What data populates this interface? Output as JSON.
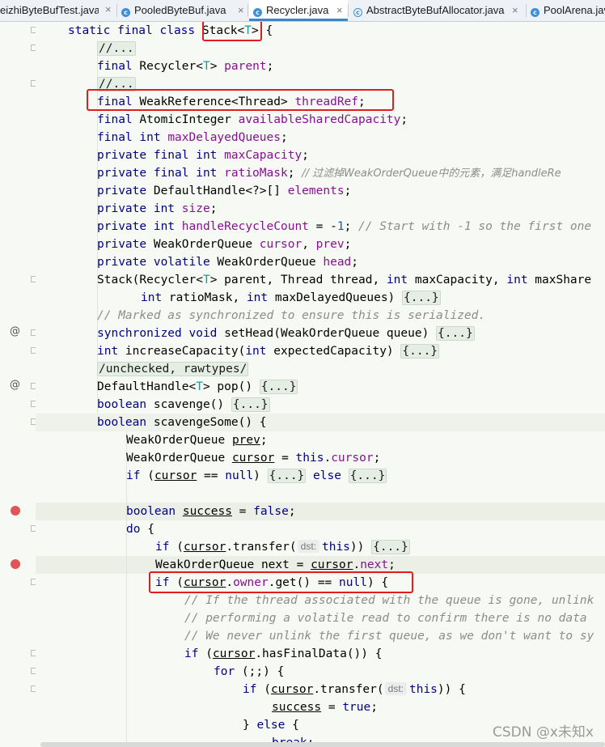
{
  "tabs": [
    {
      "label": "eizhiByteBufTest.java"
    },
    {
      "label": "PooledByteBuf.java"
    },
    {
      "label": "Recycler.java"
    },
    {
      "label": "AbstractByteBufAllocator.java"
    },
    {
      "label": "PoolArena.java"
    }
  ],
  "tab_close_glyph": "×",
  "gutter_annotation": "@",
  "watermark": "CSDN @x未知x",
  "colors": {
    "keyword": "#000080",
    "type_param": "#20999d",
    "field": "#871094",
    "comment": "#8c8c8c",
    "number": "#1750eb",
    "highlight_box": "#e21d1d",
    "breakpoint": "#e05555",
    "active_tab_accent": "#4083c9"
  },
  "code": {
    "l01": {
      "a": "static final class ",
      "b": "Stack<",
      "c": "T",
      "d": "> {"
    },
    "l02": {
      "a": "//..."
    },
    "l03": {
      "a": "final ",
      "b": "Recycler<",
      "c": "T",
      "d": "> ",
      "e": "parent",
      "f": ";"
    },
    "l04": {
      "a": "//..."
    },
    "l05": {
      "a": "final ",
      "b": "WeakReference<Thread> ",
      "c": "threadRef",
      "d": ";"
    },
    "l06": {
      "a": "final ",
      "b": "AtomicInteger ",
      "c": "availableSharedCapacity",
      "d": ";"
    },
    "l07": {
      "a": "final int ",
      "b": "maxDelayedQueues",
      "c": ";"
    },
    "l08": {
      "a": "private final int ",
      "b": "maxCapacity",
      "c": ";"
    },
    "l09": {
      "a": "private final int ",
      "b": "ratioMask",
      "c": "; ",
      "d": "// 过滤掉WeakOrderQueue中的元素，满足handleRe"
    },
    "l10": {
      "a": "private ",
      "b": "DefaultHandle<?>[] ",
      "c": "elements",
      "d": ";"
    },
    "l11": {
      "a": "private int ",
      "b": "size",
      "c": ";"
    },
    "l12": {
      "a": "private int ",
      "b": "handleRecycleCount",
      "c": " = -",
      "d": "1",
      "e": "; ",
      "f": "// Start with -1 so the first one"
    },
    "l13": {
      "a": "private ",
      "b": "WeakOrderQueue ",
      "c": "cursor",
      "d": ", ",
      "e": "prev",
      "f": ";"
    },
    "l14": {
      "a": "private volatile ",
      "b": "WeakOrderQueue ",
      "c": "head",
      "d": ";"
    },
    "l15": {
      "a": "Stack(Recycler<",
      "b": "T",
      "c": "> parent, Thread thread, ",
      "d": "int ",
      "e": "maxCapacity, ",
      "f": "int ",
      "g": "maxShare"
    },
    "l16": {
      "a": "int ",
      "b": "ratioMask, ",
      "c": "int ",
      "d": "maxDelayedQueues) ",
      "e": "{...}"
    },
    "l17": {
      "a": "// Marked as synchronized to ensure this is serialized."
    },
    "l18": {
      "a": "synchronized void ",
      "b": "setHead(WeakOrderQueue queue) ",
      "c": "{...}"
    },
    "l19": {
      "a": "int ",
      "b": "increaseCapacity(",
      "c": "int ",
      "d": "expectedCapacity) ",
      "e": "{...}"
    },
    "l20": {
      "a": "/unchecked, rawtypes/"
    },
    "l21": {
      "a": "DefaultHandle<",
      "b": "T",
      "c": "> pop() ",
      "d": "{...}"
    },
    "l22": {
      "a": "boolean ",
      "b": "scavenge() ",
      "c": "{...}"
    },
    "l23": {
      "a": "boolean ",
      "b": "scavengeSome() {"
    },
    "l24": {
      "a": "WeakOrderQueue ",
      "b": "prev",
      "c": ";"
    },
    "l25": {
      "a": "WeakOrderQueue ",
      "b": "cursor",
      "c": " = ",
      "d": "this",
      "e": ".",
      "f": "cursor",
      "g": ";"
    },
    "l26": {
      "a": "if ",
      "b": "(",
      "c": "cursor",
      "d": " == ",
      "e": "null",
      "f": ") ",
      "g": "{...}",
      "h": " else ",
      "i": "{...}"
    },
    "l28": {
      "a": "boolean ",
      "b": "success",
      "c": " = ",
      "d": "false",
      "e": ";"
    },
    "l29": {
      "a": "do ",
      "b": "{"
    },
    "l30": {
      "a": "if ",
      "b": "(",
      "c": "cursor",
      "d": ".transfer(",
      "e": "dst:",
      "f": "this",
      "g": ")) ",
      "h": "{...}"
    },
    "l31": {
      "a": "WeakOrderQueue next = ",
      "b": "cursor",
      "c": ".",
      "d": "next",
      "e": ";"
    },
    "l32": {
      "a": "if ",
      "b": "(",
      "c": "cursor",
      "d": ".",
      "e": "owner",
      "f": ".get() == ",
      "g": "null",
      "h": ") {"
    },
    "l33": {
      "a": "// If the thread associated with the queue is gone, unlink"
    },
    "l34": {
      "a": "// performing a volatile read to confirm there is no data"
    },
    "l35": {
      "a": "// We never unlink the first queue, as we don't want to sy"
    },
    "l36": {
      "a": "if ",
      "b": "(",
      "c": "cursor",
      "d": ".hasFinalData()) {"
    },
    "l37": {
      "a": "for ",
      "b": "(;;) {"
    },
    "l38": {
      "a": "if ",
      "b": "(",
      "c": "cursor",
      "d": ".transfer(",
      "e": "dst:",
      "f": "this",
      "g": ")) {"
    },
    "l39": {
      "a": "success",
      "b": " = ",
      "c": "true",
      "d": ";"
    },
    "l40": {
      "a": "} ",
      "b": "else ",
      "c": "{"
    },
    "l41": {
      "a": "break",
      "b": ";"
    }
  }
}
